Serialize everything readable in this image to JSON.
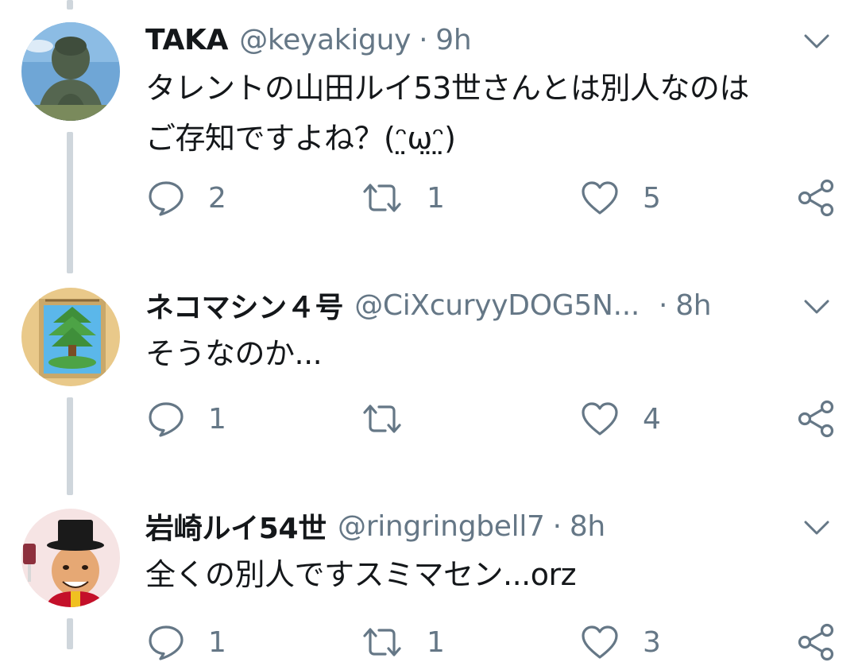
{
  "tweets": [
    {
      "display_name": "TAKA",
      "handle": "@keyakiguy",
      "separator": "·",
      "time": "9h",
      "lines": [
        "タレントの山田ルイ53世さんとは別人なのは",
        "ご存知ですよね？(ᵔ̤ω̤ᵔ̤)"
      ],
      "reply_count": "2",
      "retweet_count": "1",
      "like_count": "5",
      "avatar_icon": "buddha-statue-avatar"
    },
    {
      "display_name": "ネコマシン４号",
      "handle": "@CiXcuryyDOG5N...",
      "separator": "·",
      "time": "8h",
      "lines": [
        "そうなのか..."
      ],
      "reply_count": "1",
      "retweet_count": "",
      "like_count": "4",
      "avatar_icon": "bonsai-tree-avatar"
    },
    {
      "display_name": "岩崎ルイ54世",
      "handle": "@ringringbell7",
      "separator": "·",
      "time": "8h",
      "lines": [
        "全くの別人ですスミマセン...orz"
      ],
      "reply_count": "1",
      "retweet_count": "1",
      "like_count": "3",
      "avatar_icon": "man-top-hat-avatar"
    }
  ],
  "colors": {
    "text": "#14171a",
    "secondary": "#657786",
    "thread_line": "#cfd6dc",
    "background": "#ffffff"
  },
  "icons": {
    "reply": "reply-icon",
    "retweet": "retweet-icon",
    "like": "like-icon",
    "share": "share-icon",
    "menu": "chevron-down-icon"
  }
}
